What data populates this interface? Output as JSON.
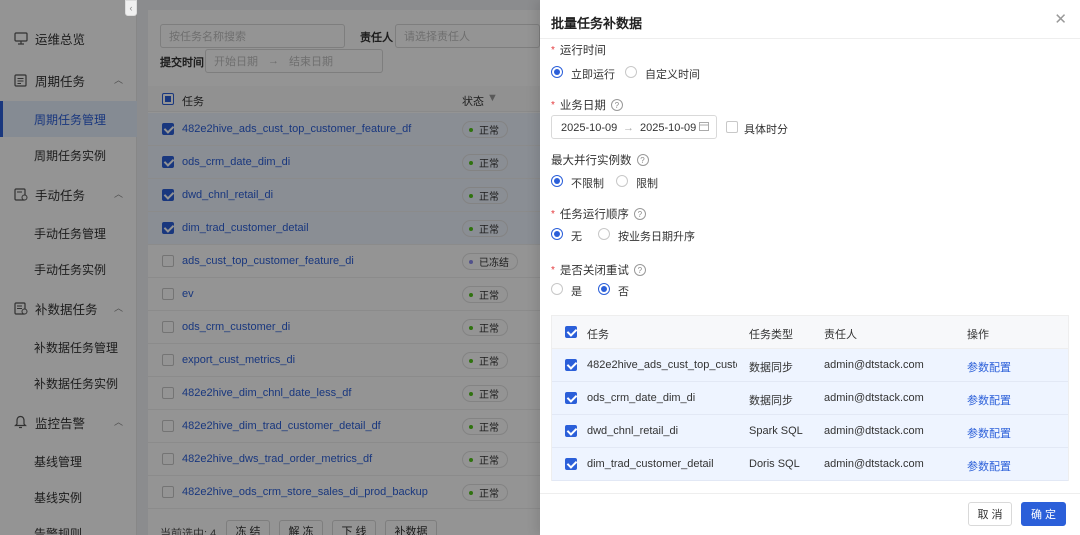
{
  "sidebar": {
    "groups": [
      {
        "label": "运维总览",
        "icon": "monitor-icon"
      },
      {
        "label": "周期任务",
        "icon": "calendar-task-icon"
      },
      {
        "label": "手动任务",
        "icon": "manual-task-icon"
      },
      {
        "label": "补数据任务",
        "icon": "backfill-icon"
      },
      {
        "label": "监控告警",
        "icon": "bell-icon"
      }
    ],
    "items": {
      "cycle_manage": "周期任务管理",
      "cycle_instance": "周期任务实例",
      "manual_manage": "手动任务管理",
      "manual_instance": "手动任务实例",
      "backfill_manage": "补数据任务管理",
      "backfill_instance": "补数据任务实例",
      "baseline_manage": "基线管理",
      "baseline_instance": "基线实例",
      "alert_rule": "告警规则"
    }
  },
  "list": {
    "search_placeholder": "按任务名称搜索",
    "owner_label": "责任人",
    "owner_placeholder": "请选择责任人",
    "submit_time_label": "提交时间",
    "start_placeholder": "开始日期",
    "end_placeholder": "结束日期",
    "col_task": "任务",
    "col_status": "状态",
    "rows": [
      {
        "name": "482e2hive_ads_cust_top_customer_feature_df",
        "status": "正常",
        "checked": true
      },
      {
        "name": "ods_crm_date_dim_di",
        "status": "正常",
        "checked": true
      },
      {
        "name": "dwd_chnl_retail_di",
        "status": "正常",
        "checked": true
      },
      {
        "name": "dim_trad_customer_detail",
        "status": "正常",
        "checked": true
      },
      {
        "name": "ads_cust_top_customer_feature_di",
        "status": "已冻结",
        "checked": false
      },
      {
        "name": "ev",
        "status": "正常",
        "checked": false
      },
      {
        "name": "ods_crm_customer_di",
        "status": "正常",
        "checked": false
      },
      {
        "name": "export_cust_metrics_di",
        "status": "正常",
        "checked": false
      },
      {
        "name": "482e2hive_dim_chnl_date_less_df",
        "status": "正常",
        "checked": false
      },
      {
        "name": "482e2hive_dim_trad_customer_detail_df",
        "status": "正常",
        "checked": false
      },
      {
        "name": "482e2hive_dws_trad_order_metrics_df",
        "status": "正常",
        "checked": false
      },
      {
        "name": "482e2hive_ods_crm_store_sales_di_prod_backup",
        "status": "正常",
        "checked": false
      }
    ],
    "selected_text": "当前选中: 4",
    "btn_freeze": "冻 结",
    "btn_unfreeze": "解 冻",
    "btn_offline": "下 线",
    "btn_backfill": "补数据"
  },
  "drawer": {
    "title": "批量任务补数据",
    "run_time_label": "运行时间",
    "run_now": "立即运行",
    "run_custom": "自定义时间",
    "biz_date_label": "业务日期",
    "date_start": "2025-10-09",
    "date_end": "2025-10-09",
    "specific_time": "具体时分",
    "max_parallel_label": "最大并行实例数",
    "unlimited": "不限制",
    "limited": "限制",
    "order_label": "任务运行顺序",
    "order_none": "无",
    "order_asc": "按业务日期升序",
    "disable_retry_label": "是否关闭重试",
    "yes": "是",
    "no": "否",
    "table": {
      "col_task": "任务",
      "col_type": "任务类型",
      "col_owner": "责任人",
      "col_action": "操作",
      "rows": [
        {
          "task": "482e2hive_ads_cust_top_custo...",
          "type": "数据同步",
          "owner": "admin@dtstack.com",
          "action": "参数配置"
        },
        {
          "task": "ods_crm_date_dim_di",
          "type": "数据同步",
          "owner": "admin@dtstack.com",
          "action": "参数配置"
        },
        {
          "task": "dwd_chnl_retail_di",
          "type": "Spark SQL",
          "owner": "admin@dtstack.com",
          "action": "参数配置"
        },
        {
          "task": "dim_trad_customer_detail",
          "type": "Doris SQL",
          "owner": "admin@dtstack.com",
          "action": "参数配置"
        }
      ]
    },
    "cancel": "取 消",
    "ok": "确 定"
  },
  "colors": {
    "accent": "#2b5fd9",
    "success": "#52c41a",
    "frozen": "#8c8cf0"
  }
}
